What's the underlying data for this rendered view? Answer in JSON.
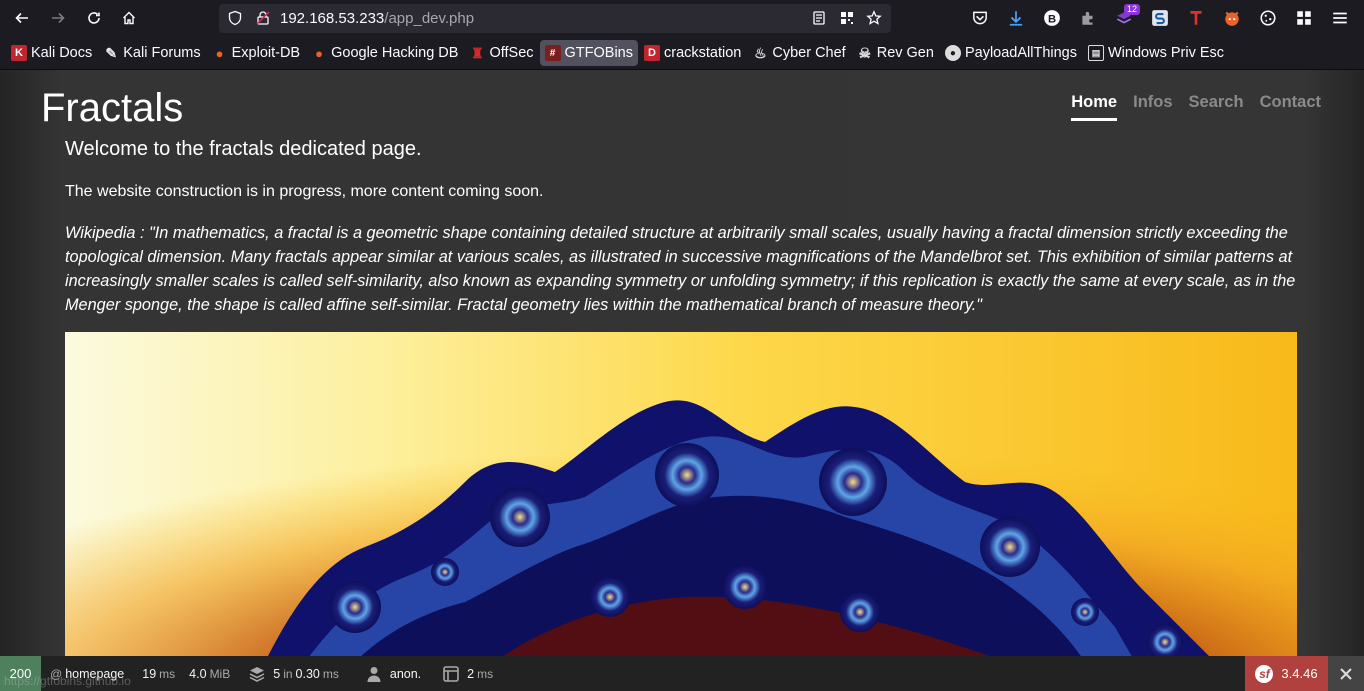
{
  "browser": {
    "url_host": "192.168.53.233",
    "url_path": "/app_dev.php",
    "extension_badge": "12",
    "status_bar_link": "https://gtfobins.github.io"
  },
  "bookmarks": [
    {
      "label": "Kali Docs",
      "icon": "kali-docs-icon"
    },
    {
      "label": "Kali Forums",
      "icon": "kali-forums-icon"
    },
    {
      "label": "Exploit-DB",
      "icon": "exploit-db-icon"
    },
    {
      "label": "Google Hacking DB",
      "icon": "ghdb-icon"
    },
    {
      "label": "OffSec",
      "icon": "offsec-icon"
    },
    {
      "label": "GTFOBins",
      "icon": "gtfobins-icon"
    },
    {
      "label": "crackstation",
      "icon": "crackstation-icon"
    },
    {
      "label": "Cyber Chef",
      "icon": "cyberchef-icon"
    },
    {
      "label": "Rev Gen",
      "icon": "revgen-icon"
    },
    {
      "label": "PayloadAllThings",
      "icon": "github-icon"
    },
    {
      "label": "Windows Priv Esc",
      "icon": "windows-priv-esc-icon"
    }
  ],
  "site": {
    "title": "Fractals",
    "nav": [
      "Home",
      "Infos",
      "Search",
      "Contact"
    ],
    "active_nav": "Home",
    "lead": "Welcome to the fractals dedicated page.",
    "paragraph": "The website construction is in progress, more content coming soon.",
    "quote": "Wikipedia : \"In mathematics, a fractal is a geometric shape containing detailed structure at arbitrarily small scales, usually having a fractal dimension strictly exceeding the topological dimension. Many fractals appear similar at various scales, as illustrated in successive magnifications of the Mandelbrot set. This exhibition of similar patterns at increasingly smaller scales is called self-similarity, also known as expanding symmetry or unfolding symmetry; if this replication is exactly the same at every scale, as in the Menger sponge, the shape is called affine self-similar. Fractal geometry lies within the mathematical branch of measure theory.\""
  },
  "debug_bar": {
    "status_code": "200",
    "route_prefix": "@",
    "route": "homepage",
    "time_value": "19",
    "time_unit": "ms",
    "memory_value": "4.0",
    "memory_unit": "MiB",
    "db_count": "5",
    "db_in": "in",
    "db_time": "0.30",
    "db_unit": "ms",
    "user": "anon.",
    "twig_value": "2",
    "twig_unit": "ms",
    "version": "3.4.46"
  },
  "colors": {
    "debug_ok": "#4f805d",
    "symfony_red": "#b0413e"
  }
}
